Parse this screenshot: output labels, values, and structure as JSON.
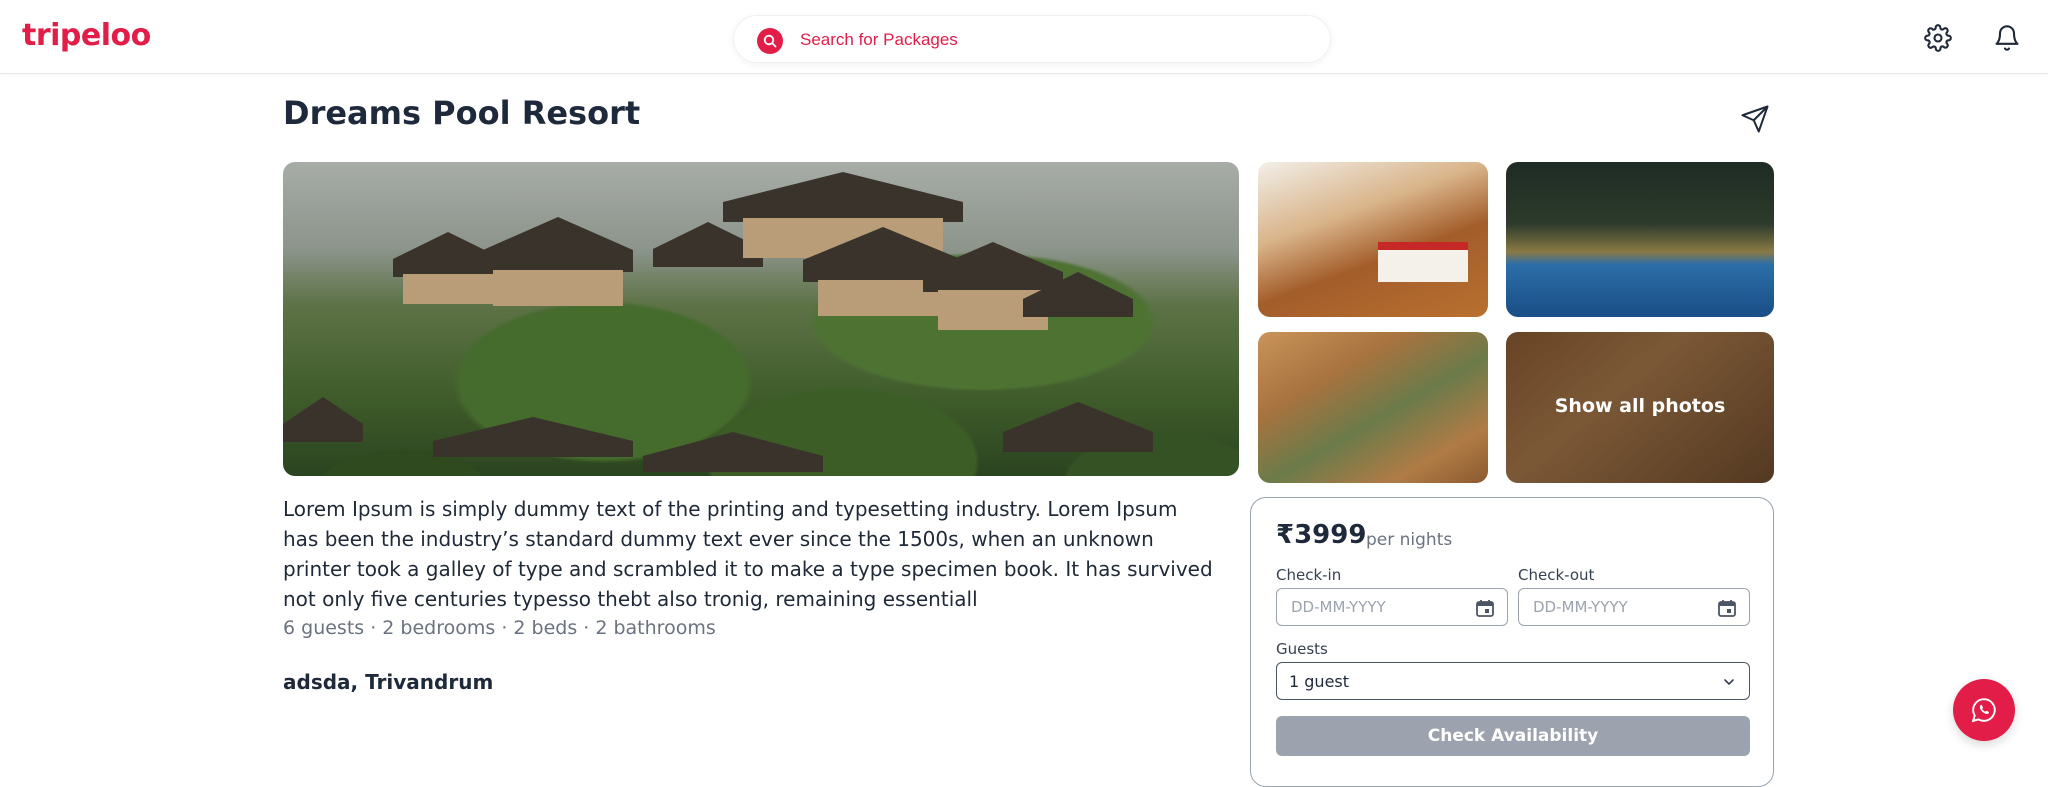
{
  "header": {
    "logo": "tripeloo",
    "search_placeholder": "Search for Packages"
  },
  "listing": {
    "title": "Dreams Pool Resort",
    "show_all_photos": "Show all photos",
    "description": "Lorem Ipsum is simply dummy text of the printing and typesetting industry. Lorem Ipsum has been the industry’s standard dummy text ever since the 1500s, when an unknown printer took a galley of type and scrambled it to make a type specimen book. It has survived not only five centuries typesso thebt also tronig, remaining essentiall",
    "meta": "6 guests · 2 bedrooms · 2 beds · 2 bathrooms",
    "location": "adsda, Trivandrum"
  },
  "booking": {
    "price": "₹3999",
    "per": "per nights",
    "checkin_label": "Check-in",
    "checkout_label": "Check-out",
    "date_placeholder": "DD-MM-YYYY",
    "guests_label": "Guests",
    "guests_value": "1 guest",
    "button": "Check Availability"
  },
  "colors": {
    "brand": "#e11d48",
    "text_dark": "#1e2a3b",
    "muted": "#6b7280",
    "button_disabled": "#9ca3af"
  },
  "icons": [
    "search-icon",
    "gear-icon",
    "bell-icon",
    "send-icon",
    "calendar-icon",
    "chevron-down-icon",
    "whatsapp-icon"
  ]
}
